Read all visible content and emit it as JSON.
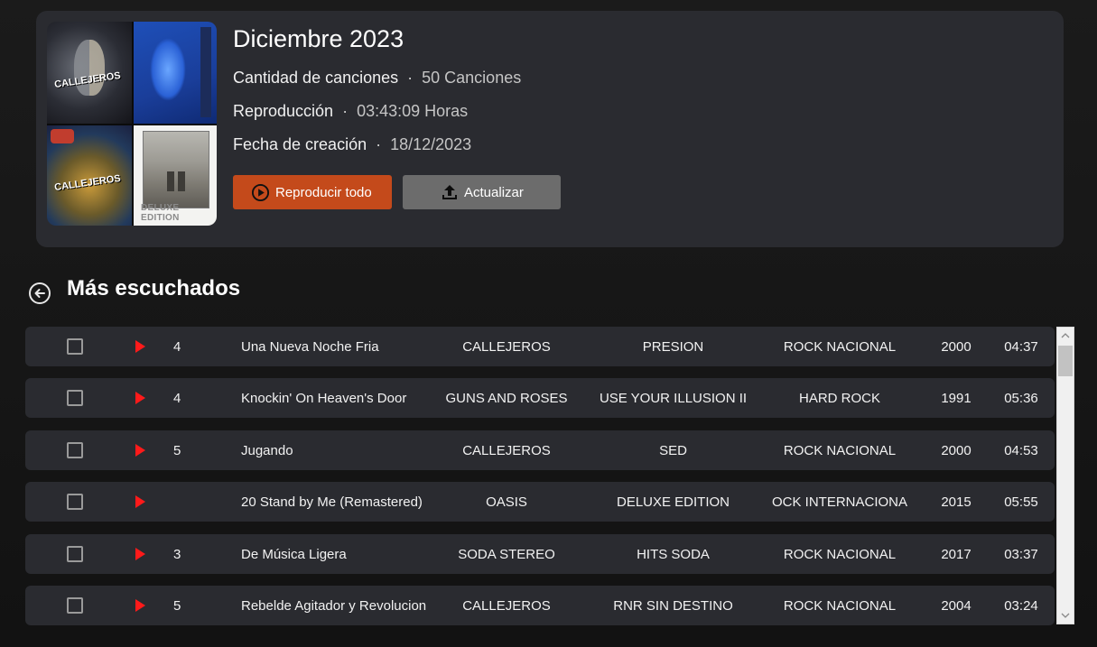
{
  "header": {
    "title": "Diciembre 2023",
    "song_count_label": "Cantidad de canciones",
    "song_count_value": "50 Canciones",
    "duration_label": "Reproducción",
    "duration_value": "03:43:09 Horas",
    "created_label": "Fecha de creación",
    "created_value": "18/12/2023",
    "play_all_label": "Reproducir todo",
    "update_label": "Actualizar",
    "separator": "·",
    "covers": [
      {
        "tag": "CALLEJEROS"
      },
      {
        "tag": ""
      },
      {
        "tag": "CALLEJEROS"
      },
      {
        "tag": "DELUXE EDITION"
      }
    ]
  },
  "section": {
    "title": "Más escuchados"
  },
  "colors": {
    "accent_play": "#c44a1b",
    "update_button": "#6c6c6c",
    "row_bg": "#2a2b30",
    "play_icon": "#ff1a1a"
  },
  "tracks": [
    {
      "num": "4",
      "title": "Una Nueva Noche Fria",
      "artist": "CALLEJEROS",
      "album": "PRESION",
      "genre": "ROCK NACIONAL",
      "year": "2000",
      "duration": "04:37"
    },
    {
      "num": "4",
      "title": "Knockin' On Heaven's Door",
      "artist": "GUNS AND ROSES",
      "album": "USE YOUR ILLUSION II",
      "genre": "HARD ROCK",
      "year": "1991",
      "duration": "05:36"
    },
    {
      "num": "5",
      "title": "Jugando",
      "artist": "CALLEJEROS",
      "album": "SED",
      "genre": "ROCK NACIONAL",
      "year": "2000",
      "duration": "04:53"
    },
    {
      "num": "",
      "title": "20 Stand by Me (Remastered)",
      "artist": "OASIS",
      "album": "DELUXE EDITION",
      "genre": "OCK INTERNACIONA",
      "year": "2015",
      "duration": "05:55"
    },
    {
      "num": "3",
      "title": "De Música Ligera",
      "artist": "SODA STEREO",
      "album": "HITS SODA",
      "genre": "ROCK NACIONAL",
      "year": "2017",
      "duration": "03:37"
    },
    {
      "num": "5",
      "title": "Rebelde Agitador y Revolucion",
      "artist": "CALLEJEROS",
      "album": "RNR SIN DESTINO",
      "genre": "ROCK NACIONAL",
      "year": "2004",
      "duration": "03:24"
    }
  ],
  "icons": {
    "play_all": "play-circle-icon",
    "update": "upload-icon",
    "back": "back-arrow-circle-icon",
    "row_play": "play-triangle-icon",
    "scroll_up": "chevron-up-icon",
    "scroll_down": "chevron-down-icon"
  }
}
